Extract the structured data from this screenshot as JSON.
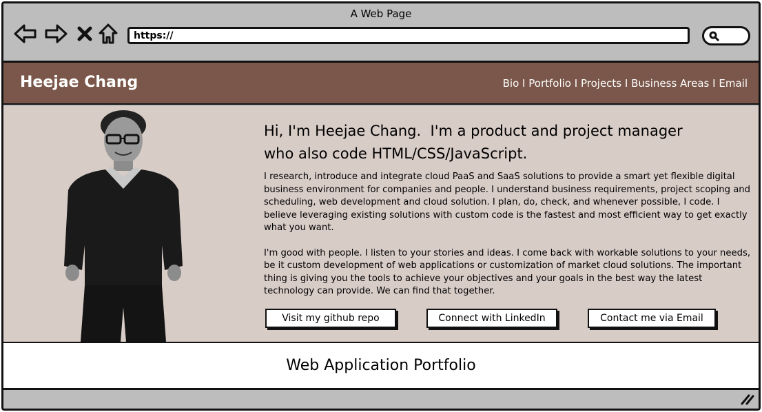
{
  "browser": {
    "title": "A Web Page",
    "url": "https://",
    "icons": [
      "back-arrow-icon",
      "forward-arrow-icon",
      "close-icon",
      "home-icon",
      "search-icon",
      "resize-grip-icon"
    ]
  },
  "header": {
    "brand": "Heejae Chang",
    "nav": [
      {
        "label": "Bio"
      },
      {
        "label": "Portfolio"
      },
      {
        "label": "Projects"
      },
      {
        "label": "Business Areas"
      },
      {
        "label": "Email"
      }
    ],
    "separator": "I",
    "bg_color": "#7a574a"
  },
  "hero": {
    "bg_color": "#d8ccc7",
    "headline_line1": "Hi, I'm Heejae Chang.  I'm a product and project manager",
    "headline_line2": "who also code HTML/CSS/JavaScript.",
    "paragraph1": "I research, introduce and integrate cloud PaaS and SaaS solutions to provide a smart yet flexible digital business environment for companies and people. I understand business requirements, project scoping and scheduling, web development and cloud solution. I plan, do, check, and whenever possible, I code. I believe leveraging existing solutions with custom code is the fastest and most efficient way to get exactly what you want.",
    "paragraph2": "I'm good with people. I listen to your stories and ideas. I come back with workable solutions to your needs, be it custom development of web applications or customization of market cloud solutions. The important thing is giving you the tools to achieve your objectives and your goals in the best way the latest technology can provide. We can find that together.",
    "buttons": {
      "github": "Visit my github repo",
      "linkedin": "Connect with LinkedIn",
      "email": "Contact me via Email"
    }
  },
  "main": {
    "section_title": "Web Application Portfolio"
  }
}
